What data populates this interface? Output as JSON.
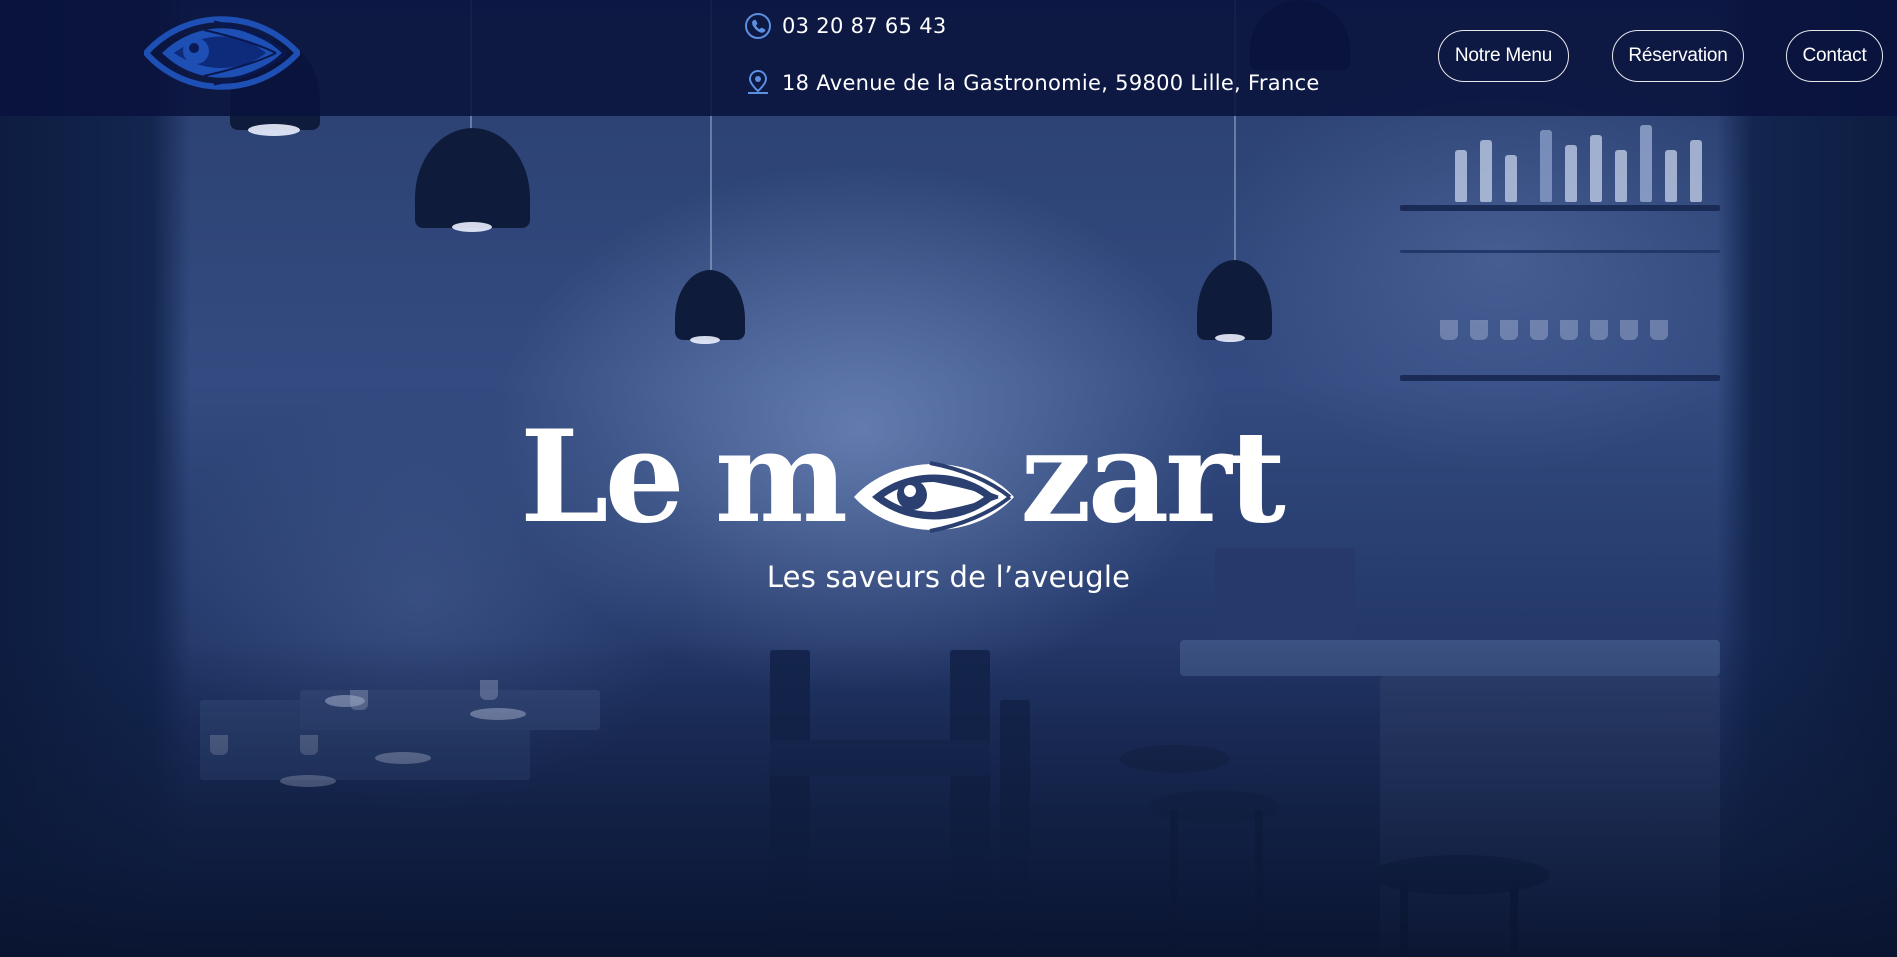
{
  "header": {
    "logo_icon": "eye-icon",
    "phone_icon": "phone-icon",
    "phone": "03 20 87 65 43",
    "address_icon": "location-pin-icon",
    "address": "18 Avenue de la Gastronomie, 59800 Lille, France",
    "nav": {
      "menu": "Notre Menu",
      "reservation": "Réservation",
      "contact": "Contact"
    }
  },
  "hero": {
    "title_part1": "Le",
    "title_part2": "m",
    "title_eye_icon": "eye-icon",
    "title_part3": "zart",
    "tagline": "Les saveurs de l’aveugle"
  },
  "colors": {
    "header_bg": "#09123c",
    "logo_blue": "#1d4fb4",
    "icon_blue": "#5b8fe0",
    "hero_tint": "#2a3f70",
    "text": "#ffffff"
  }
}
